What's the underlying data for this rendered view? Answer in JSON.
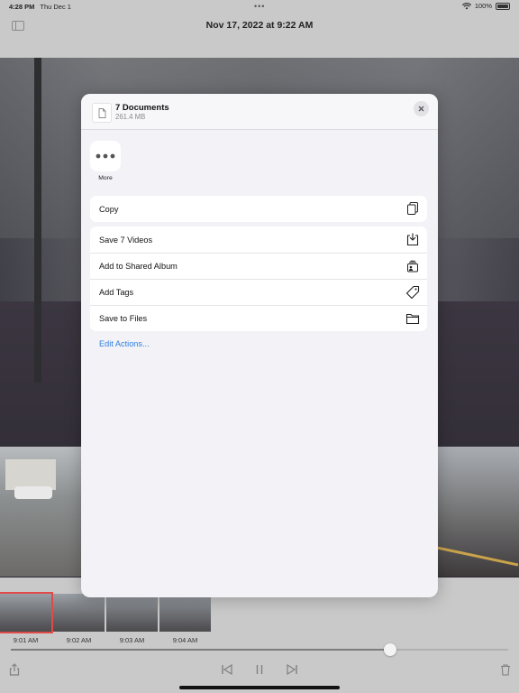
{
  "status_bar": {
    "time": "4:28 PM",
    "date": "Thu Dec 1",
    "center_dots": "•••",
    "battery": "100%"
  },
  "header": {
    "title": "Nov 17, 2022 at 9:22 AM"
  },
  "filmstrip": {
    "thumbnails": [
      {
        "label": "9:01 AM",
        "selected": true
      },
      {
        "label": "9:02 AM",
        "selected": false
      },
      {
        "label": "9:03 AM",
        "selected": false
      },
      {
        "label": "9:04 AM",
        "selected": false
      }
    ]
  },
  "playback": {
    "progress_fraction": 0.76
  },
  "share_sheet": {
    "title": "7 Documents",
    "subtitle": "261.4 MB",
    "app_tiles": [
      {
        "label": "More",
        "icon": "ellipsis-icon"
      }
    ],
    "actions_group_1": [
      {
        "label": "Copy",
        "icon": "copy-icon"
      }
    ],
    "actions_group_2": [
      {
        "label": "Save 7 Videos",
        "icon": "save-to-photos-icon"
      },
      {
        "label": "Add to Shared Album",
        "icon": "shared-album-icon"
      },
      {
        "label": "Add Tags",
        "icon": "tag-icon"
      },
      {
        "label": "Save to Files",
        "icon": "folder-icon"
      }
    ],
    "edit_actions_label": "Edit Actions..."
  },
  "colors": {
    "accent_blue": "#2f7fe0",
    "selected_thumb": "#e24a4a"
  }
}
